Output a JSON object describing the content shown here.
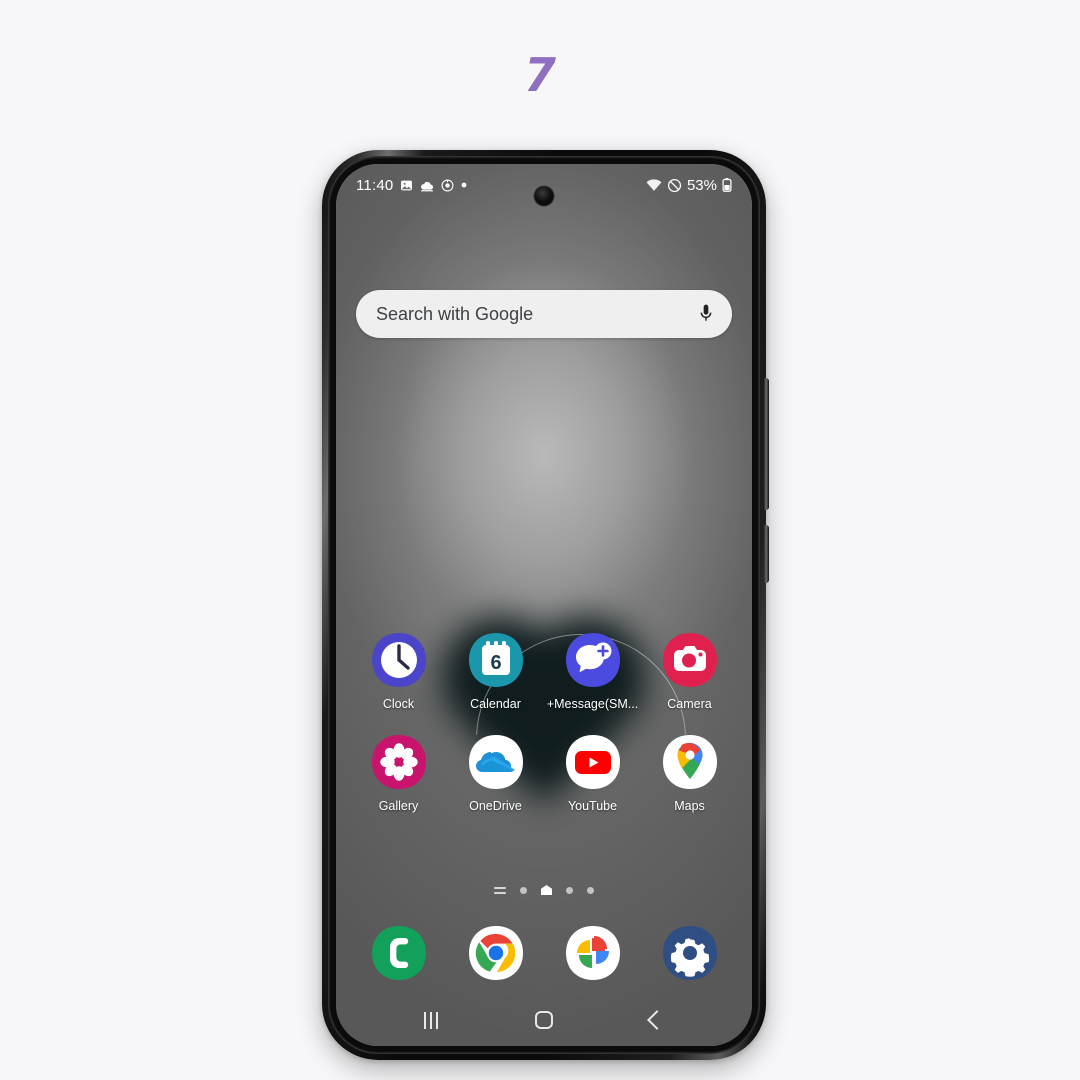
{
  "page": {
    "number": "7",
    "number_color": "#8f6fc0",
    "background_color": "#f7f6f8"
  },
  "device": {
    "frame_color": "#0a0a0a",
    "buttons": [
      "volume-rocker",
      "power-button"
    ]
  },
  "status_bar": {
    "time": "11:40",
    "battery_percent": "53%",
    "left_icons": [
      "image-icon",
      "cloud-icon",
      "target-icon",
      "dot-icon"
    ],
    "right_icons": [
      "wifi-icon",
      "do-not-disturb-icon",
      "battery-icon"
    ]
  },
  "search": {
    "placeholder": "Search with Google",
    "value": "",
    "mic_icon": "microphone-icon",
    "background_color": "#efefef"
  },
  "home_screen": {
    "rows": [
      [
        {
          "label": "Clock",
          "icon": "clock-icon",
          "color": "#4b46c9"
        },
        {
          "label": "Calendar",
          "icon": "calendar-icon",
          "color": "#1a97ab",
          "day": "6"
        },
        {
          "label": "+Message(SM...",
          "icon": "message-plus-icon",
          "color": "#4b4bdf"
        },
        {
          "label": "Camera",
          "icon": "camera-icon",
          "color": "#e0214f"
        }
      ],
      [
        {
          "label": "Gallery",
          "icon": "gallery-flower-icon",
          "color": "#c9146e"
        },
        {
          "label": "OneDrive",
          "icon": "onedrive-cloud-icon",
          "color": "#ffffff"
        },
        {
          "label": "YouTube",
          "icon": "youtube-icon",
          "color": "#ffffff"
        },
        {
          "label": "Maps",
          "icon": "google-maps-pin-icon",
          "color": "#ffffff"
        }
      ]
    ],
    "page_indicator": {
      "items": [
        "app-list-glyph",
        "dot",
        "home-page-active",
        "dot",
        "dot"
      ],
      "active_index": 2
    },
    "dock": [
      {
        "label": "Phone",
        "icon": "phone-icon",
        "color": "#13a05a"
      },
      {
        "label": "Chrome",
        "icon": "chrome-icon",
        "color": "#ffffff"
      },
      {
        "label": "Photos",
        "icon": "google-photos-icon",
        "color": "#ffffff"
      },
      {
        "label": "Settings",
        "icon": "settings-gear-icon",
        "color": "#2f4f84"
      }
    ]
  },
  "nav_bar": {
    "recents_label": "Recents",
    "home_label": "Home",
    "back_label": "Back"
  }
}
